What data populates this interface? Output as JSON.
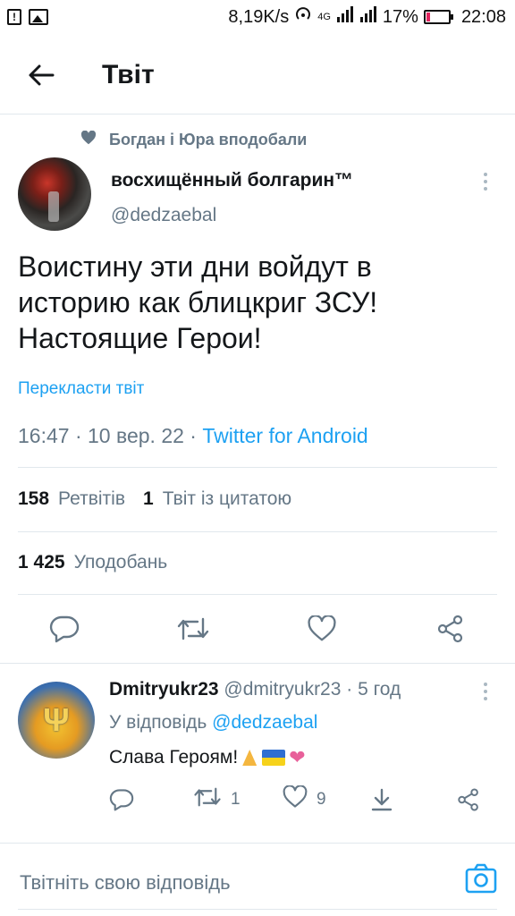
{
  "status_bar": {
    "speed": "8,19K/s",
    "network": "4G",
    "battery": "17%",
    "time": "22:08"
  },
  "header": {
    "title": "Твіт"
  },
  "tweet": {
    "liked_by": "Богдан і Юра вподобали",
    "author_name": "восхищённый болгарин™",
    "author_handle": "@dedzaebal",
    "text_lines": [
      "Воистину эти дни войдут в",
      "историю как блицкриг ЗСУ!",
      "Настоящие Герои!"
    ],
    "translate": "Перекласти твіт",
    "time": "16:47",
    "date": "10 вер. 22",
    "source": "Twitter for Android",
    "retweets_count": "158",
    "retweets_label": "Ретвітів",
    "quotes_count": "1",
    "quotes_label": "Твіт із цитатою",
    "likes_count": "1 425",
    "likes_label": "Уподобань"
  },
  "reply": {
    "name": "Dmitryukr23",
    "handle": "@dmitryukr23",
    "age": "5 год",
    "reply_to_label": "У відповідь",
    "reply_to_handle": "@dedzaebal",
    "text": "Слава Героям!",
    "retweet_count": "1",
    "like_count": "9"
  },
  "compose": {
    "placeholder": "Твітніть свою відповідь"
  },
  "colors": {
    "accent": "#1da1f2",
    "muted": "#657786",
    "text": "#14171a",
    "divider": "#e1e8ed"
  }
}
